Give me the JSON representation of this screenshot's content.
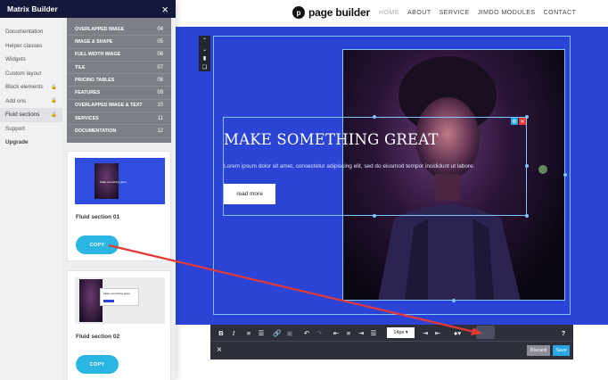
{
  "panel": {
    "title": "Matrix Builder",
    "close_icon": "×",
    "nav": [
      {
        "label": "Documentation",
        "locked": false
      },
      {
        "label": "Helper classes",
        "locked": false
      },
      {
        "label": "Widgets",
        "locked": false
      },
      {
        "label": "Custom layout",
        "locked": false
      },
      {
        "label": "Block elements",
        "locked": true
      },
      {
        "label": "Add ons",
        "locked": true
      },
      {
        "label": "Fluid sections",
        "locked": true
      },
      {
        "label": "Support",
        "locked": false
      },
      {
        "label": "Upgrade",
        "locked": false
      }
    ],
    "categories": [
      {
        "label": "OVERLAPPED IMAGE",
        "count": "04"
      },
      {
        "label": "IMAGE & SHAPE",
        "count": "05"
      },
      {
        "label": "FULL WIDTH IMAGE",
        "count": "06"
      },
      {
        "label": "TILE",
        "count": "07"
      },
      {
        "label": "PRICING TABLES",
        "count": "08"
      },
      {
        "label": "FEATURES",
        "count": "09"
      },
      {
        "label": "OVERLAPPED IMAGE & TEXT",
        "count": "10"
      },
      {
        "label": "SERVICES",
        "count": "11"
      },
      {
        "label": "DOCUMENTATION",
        "count": "12"
      }
    ],
    "cards": [
      {
        "title": "Fluid section 01",
        "copy_label": "COPY",
        "thumb_caption": "Make something great"
      },
      {
        "title": "Fluid section 02",
        "copy_label": "COPY",
        "thumb_caption": "Make something great"
      }
    ]
  },
  "site": {
    "logo_mark": "p",
    "logo_text": "page builder",
    "menu": [
      "HOME",
      "ABOUT",
      "SERVICE",
      "JIMDO MODULES",
      "CONTACT"
    ],
    "hero_title": "MAKE SOMETHING GREAT",
    "hero_sub": "Lorem ipsum dolor sit amet, consectetur adipiscing elit, sed do eiusmod tempor incididunt ut labore.",
    "read_more": "read more",
    "colors": {
      "hero_bg": "#2b44d6",
      "nav_dark": "#14183a",
      "accent": "#2bb5e3",
      "arrow": "#e53935"
    }
  },
  "toolbar": {
    "bold": "B",
    "italic": "I",
    "font_size": "14px",
    "help": "?",
    "code": "</>",
    "discard_label": "Discard",
    "save_label": "Save",
    "close_icon": "×"
  }
}
